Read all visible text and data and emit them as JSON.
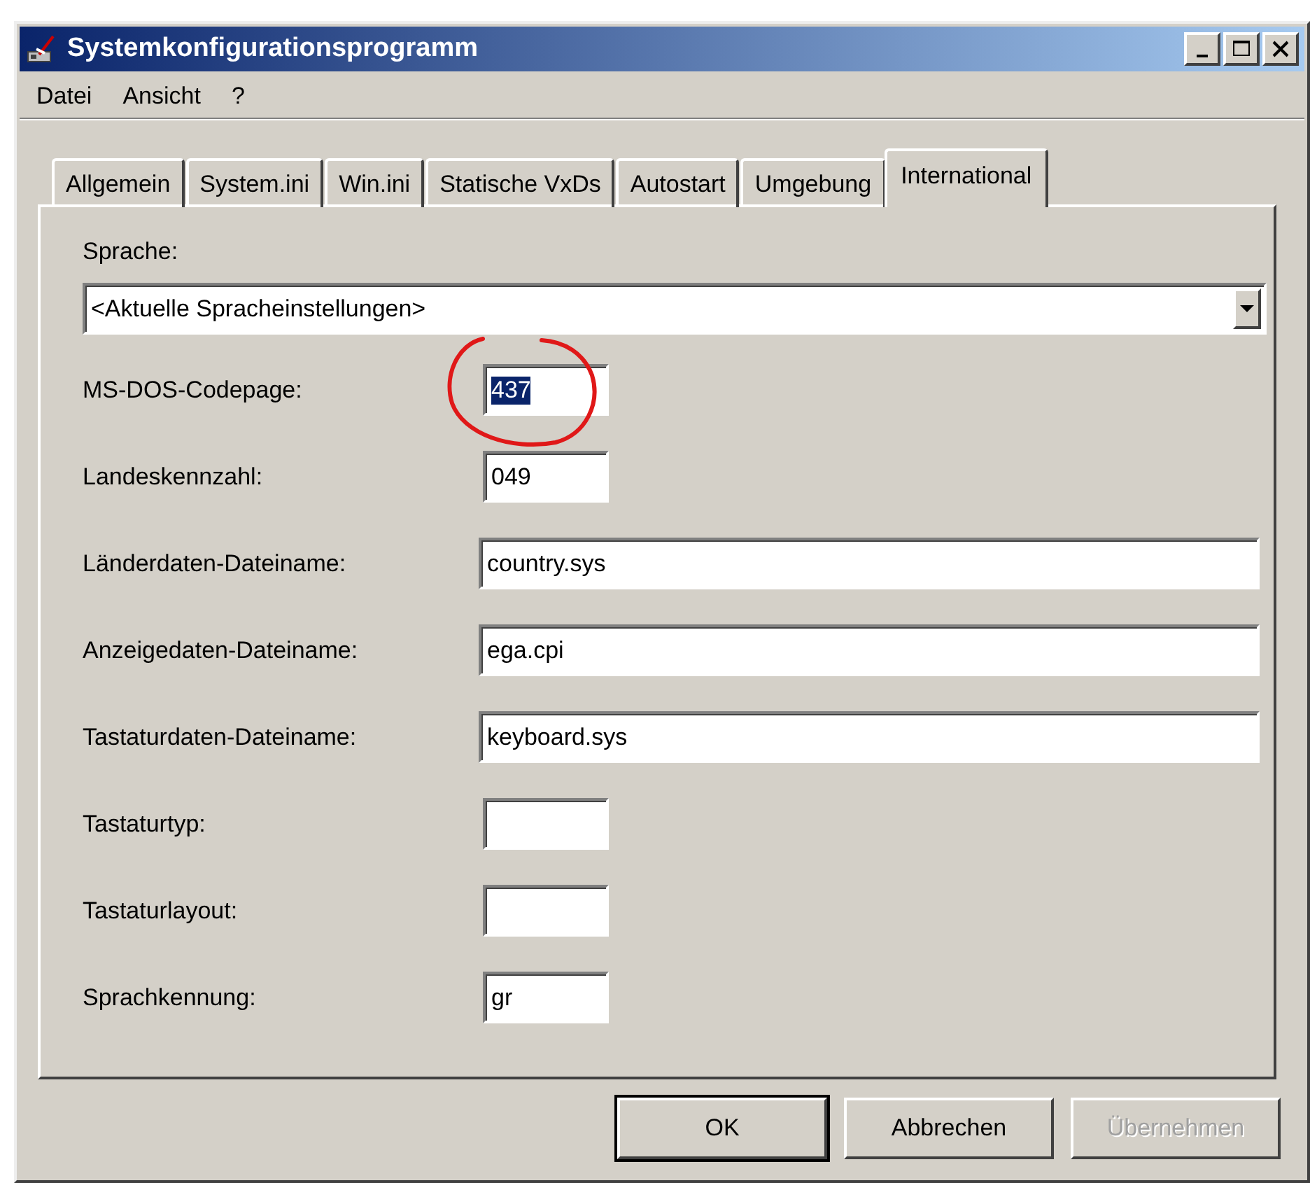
{
  "window": {
    "title": "Systemkonfigurationsprogramm"
  },
  "menu": [
    {
      "label": "Datei"
    },
    {
      "label": "Ansicht"
    },
    {
      "label": "?"
    }
  ],
  "tabs": [
    {
      "label": "Allgemein",
      "selected": false
    },
    {
      "label": "System.ini",
      "selected": false
    },
    {
      "label": "Win.ini",
      "selected": false
    },
    {
      "label": "Statische VxDs",
      "selected": false
    },
    {
      "label": "Autostart",
      "selected": false
    },
    {
      "label": "Umgebung",
      "selected": false
    },
    {
      "label": "International",
      "selected": true
    }
  ],
  "language": {
    "label": "Sprache:",
    "value": "<Aktuelle Spracheinstellungen>"
  },
  "fields": [
    {
      "label": "MS-DOS-Codepage:",
      "value": "437",
      "kind": "short",
      "text_selected": true,
      "circled": true
    },
    {
      "label": "Landeskennzahl:",
      "value": "049",
      "kind": "short",
      "text_selected": false,
      "circled": false
    },
    {
      "label": "Länderdaten-Dateiname:",
      "value": "country.sys",
      "kind": "long",
      "text_selected": false,
      "circled": false
    },
    {
      "label": "Anzeigedaten-Dateiname:",
      "value": "ega.cpi",
      "kind": "long",
      "text_selected": false,
      "circled": false
    },
    {
      "label": "Tastaturdaten-Dateiname:",
      "value": "keyboard.sys",
      "kind": "long",
      "text_selected": false,
      "circled": false
    },
    {
      "label": "Tastaturtyp:",
      "kind": "short",
      "text_selected": false,
      "circled": false
    },
    {
      "label": "Tastaturlayout:",
      "kind": "short",
      "text_selected": false,
      "circled": false
    },
    {
      "label": "Sprachkennung:",
      "value": "gr",
      "kind": "short",
      "text_selected": false,
      "circled": false
    }
  ],
  "buttons": [
    {
      "label": "OK",
      "default": true,
      "disabled": false
    },
    {
      "label": "Abbrechen",
      "default": false,
      "disabled": false
    },
    {
      "label": "Übernehmen",
      "default": false,
      "disabled": true
    }
  ]
}
